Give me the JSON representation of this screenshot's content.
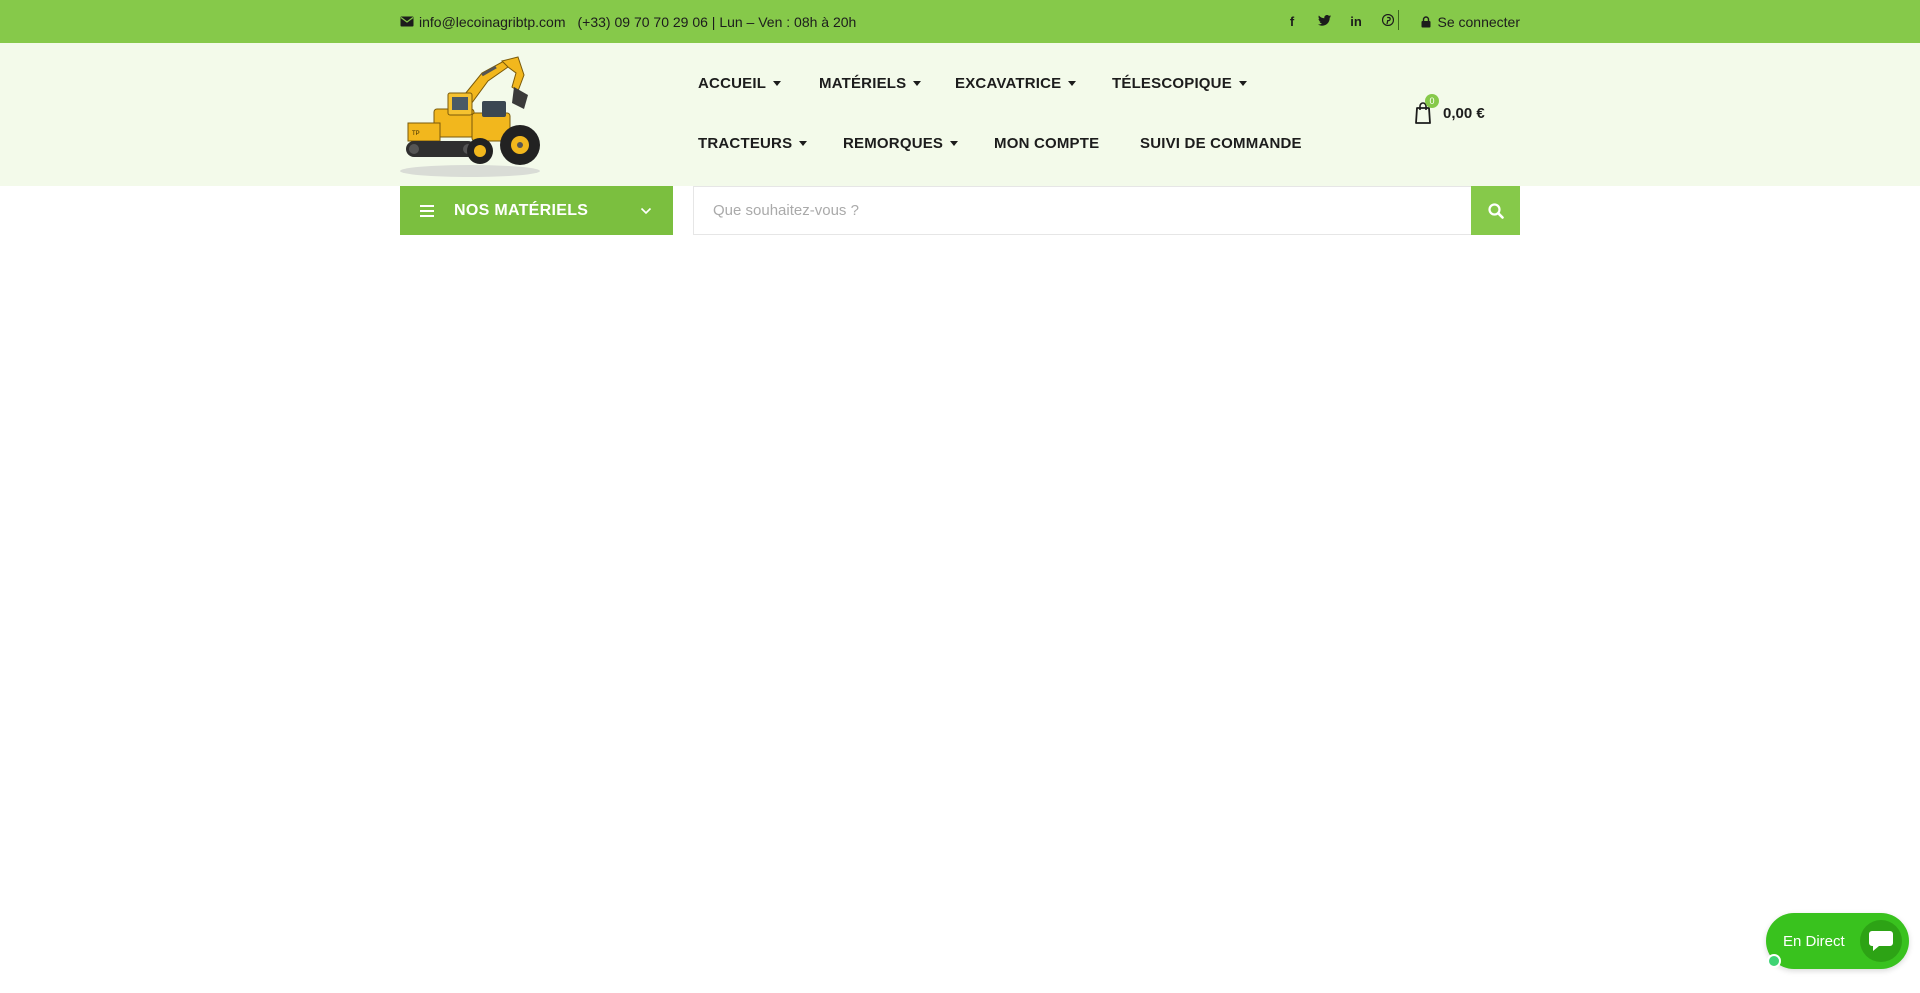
{
  "topbar": {
    "email": "info@lecoinagribtp.com",
    "phone_hours": "(+33) 09 70 70 29 06 | Lun – Ven : 08h à 20h",
    "socials": [
      {
        "name": "facebook-icon",
        "glyph": "f"
      },
      {
        "name": "twitter-icon",
        "glyph": "t"
      },
      {
        "name": "linkedin-icon",
        "glyph": "in"
      },
      {
        "name": "pinterest-icon",
        "glyph": "p"
      }
    ],
    "login_label": "Se connecter"
  },
  "nav": {
    "items": [
      {
        "label": "ACCUEIL",
        "has_dropdown": true
      },
      {
        "label": "MATÉRIELS",
        "has_dropdown": true
      },
      {
        "label": "EXCAVATRICE",
        "has_dropdown": true
      },
      {
        "label": "TÉLESCOPIQUE",
        "has_dropdown": true
      },
      {
        "label": "TRACTEURS",
        "has_dropdown": true
      },
      {
        "label": "REMORQUES",
        "has_dropdown": true
      },
      {
        "label": "MON COMPTE",
        "has_dropdown": false
      },
      {
        "label": "SUIVI DE COMMANDE",
        "has_dropdown": false
      }
    ]
  },
  "cart": {
    "count": "0",
    "total": "0,00 €"
  },
  "categories": {
    "label": "NOS MATÉRIELS"
  },
  "search": {
    "placeholder": "Que souhaitez-vous ?"
  },
  "chat": {
    "label": "En Direct"
  },
  "colors": {
    "topbar": "#86c94a",
    "header_bg": "#f3faea",
    "accent": "#7bbf3f",
    "chat": "#39c21e"
  }
}
